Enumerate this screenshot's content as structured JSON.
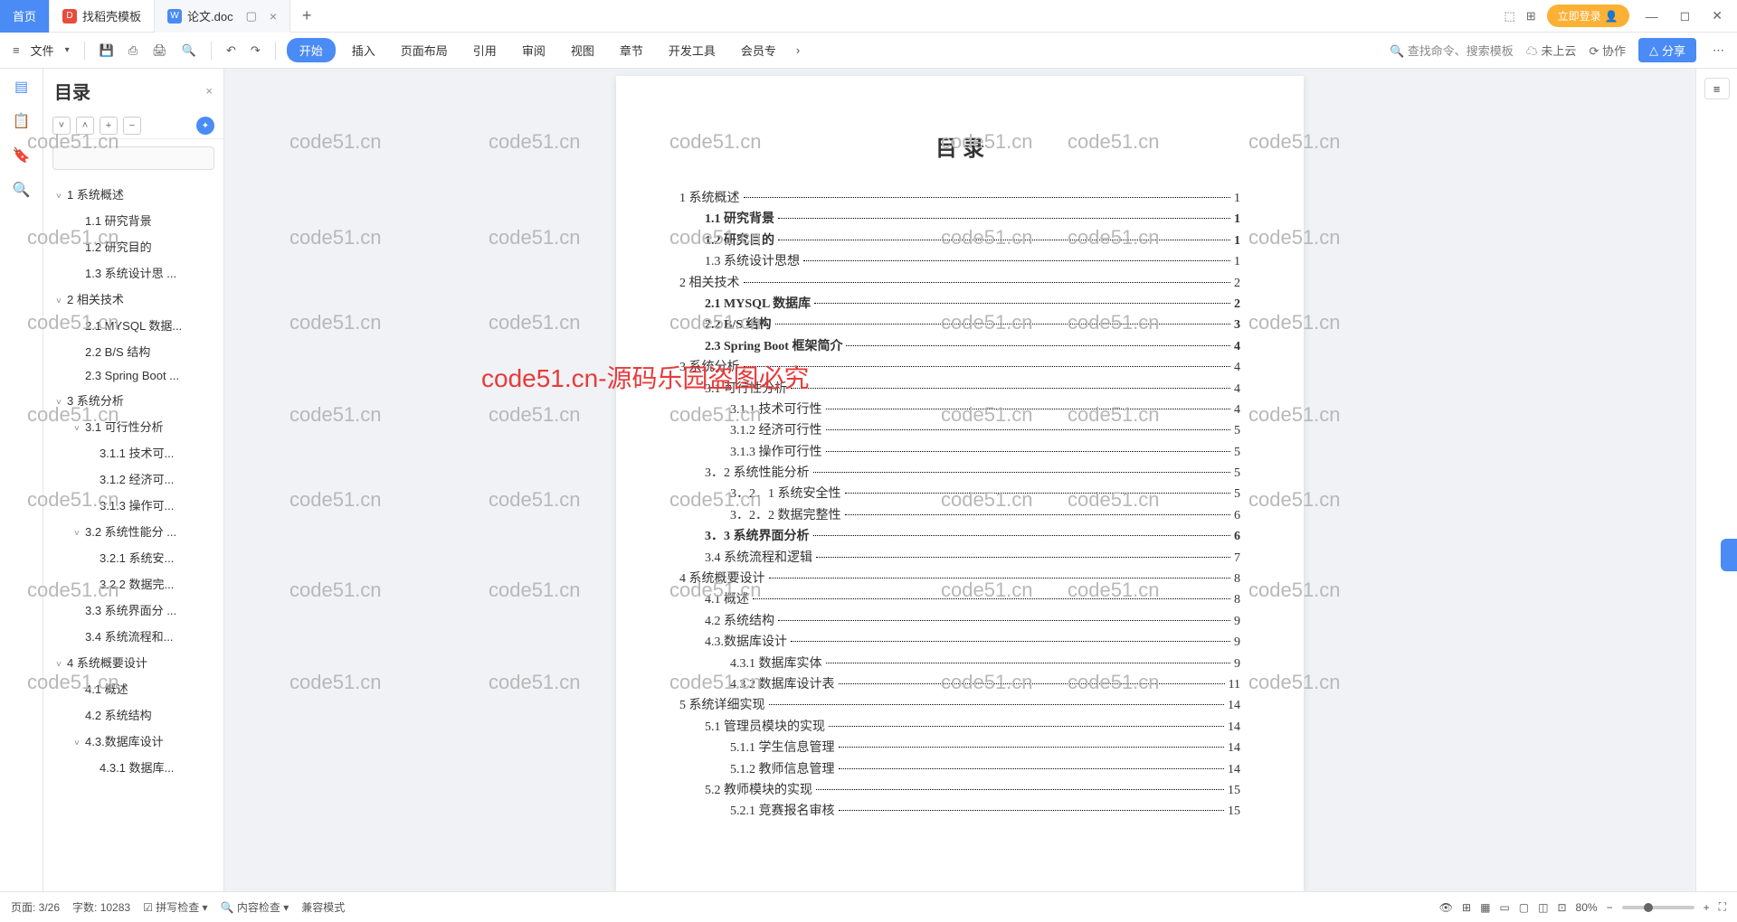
{
  "tabs": {
    "home": "首页",
    "t1": "找稻壳模板",
    "t2": "论文.doc"
  },
  "titlebar": {
    "login": "立即登录"
  },
  "ribbon": {
    "file": "文件",
    "menu": [
      "开始",
      "插入",
      "页面布局",
      "引用",
      "审阅",
      "视图",
      "章节",
      "开发工具",
      "会员专"
    ],
    "search_placeholder": "查找命令、搜索模板",
    "cloud": "未上云",
    "collab": "协作",
    "share": "分享"
  },
  "outline": {
    "title": "目录",
    "items": [
      {
        "lvl": 1,
        "chev": "˅",
        "text": "1 系统概述"
      },
      {
        "lvl": 2,
        "text": "1.1 研究背景"
      },
      {
        "lvl": 2,
        "text": "1.2 研究目的"
      },
      {
        "lvl": 2,
        "text": "1.3 系统设计思 ..."
      },
      {
        "lvl": 1,
        "chev": "˅",
        "text": "2 相关技术"
      },
      {
        "lvl": 2,
        "text": "2.1 MYSQL 数据..."
      },
      {
        "lvl": 2,
        "text": "2.2 B/S 结构"
      },
      {
        "lvl": 2,
        "text": "2.3 Spring Boot ..."
      },
      {
        "lvl": 1,
        "chev": "˅",
        "text": "3 系统分析"
      },
      {
        "lvl": 2,
        "chev": "˅",
        "text": "3.1 可行性分析"
      },
      {
        "lvl": 3,
        "text": "3.1.1 技术可..."
      },
      {
        "lvl": 3,
        "text": "3.1.2 经济可..."
      },
      {
        "lvl": 3,
        "text": "3.1.3 操作可..."
      },
      {
        "lvl": 2,
        "chev": "˅",
        "text": "3.2 系统性能分 ..."
      },
      {
        "lvl": 3,
        "text": "3.2.1 系统安..."
      },
      {
        "lvl": 3,
        "text": "3.2.2 数据完..."
      },
      {
        "lvl": 2,
        "text": "3.3 系统界面分 ..."
      },
      {
        "lvl": 2,
        "text": "3.4 系统流程和..."
      },
      {
        "lvl": 1,
        "chev": "˅",
        "text": "4 系统概要设计"
      },
      {
        "lvl": 2,
        "text": "4.1 概述"
      },
      {
        "lvl": 2,
        "text": "4.2 系统结构"
      },
      {
        "lvl": 2,
        "chev": "˅",
        "text": "4.3.数据库设计"
      },
      {
        "lvl": 3,
        "text": "4.3.1 数据库..."
      }
    ]
  },
  "document": {
    "title": "目 录",
    "toc": [
      {
        "lvl": 1,
        "bold": false,
        "text": "1 系统概述",
        "page": "1"
      },
      {
        "lvl": 2,
        "bold": true,
        "text": "1.1  研究背景",
        "page": "1"
      },
      {
        "lvl": 2,
        "bold": true,
        "text": "1.2 研究目的",
        "page": "1"
      },
      {
        "lvl": 2,
        "bold": false,
        "text": "1.3 系统设计思想",
        "page": "1"
      },
      {
        "lvl": 1,
        "bold": false,
        "text": "2 相关技术",
        "page": "2"
      },
      {
        "lvl": 2,
        "bold": true,
        "text": "2.1 MYSQL 数据库",
        "page": "2"
      },
      {
        "lvl": 2,
        "bold": true,
        "text": "2.2 B/S 结构",
        "page": "3"
      },
      {
        "lvl": 2,
        "bold": true,
        "text": "2.3 Spring Boot 框架简介",
        "page": "4"
      },
      {
        "lvl": 1,
        "bold": false,
        "text": "3 系统分析",
        "page": "4"
      },
      {
        "lvl": 2,
        "bold": false,
        "text": "3.1 可行性分析",
        "page": "4"
      },
      {
        "lvl": 3,
        "bold": false,
        "text": "3.1.1 技术可行性",
        "page": "4"
      },
      {
        "lvl": 3,
        "bold": false,
        "text": "3.1.2 经济可行性",
        "page": "5"
      },
      {
        "lvl": 3,
        "bold": false,
        "text": "3.1.3 操作可行性",
        "page": "5"
      },
      {
        "lvl": 2,
        "bold": false,
        "text": "3．2 系统性能分析",
        "page": "5"
      },
      {
        "lvl": 3,
        "bold": false,
        "text": "3．2．1  系统安全性",
        "page": "5"
      },
      {
        "lvl": 3,
        "bold": false,
        "text": "3．2．2  数据完整性",
        "page": "6"
      },
      {
        "lvl": 2,
        "bold": true,
        "text": "3．3 系统界面分析",
        "page": "6"
      },
      {
        "lvl": 2,
        "bold": false,
        "text": "3.4 系统流程和逻辑",
        "page": "7"
      },
      {
        "lvl": 1,
        "bold": false,
        "text": "4 系统概要设计",
        "page": "8"
      },
      {
        "lvl": 2,
        "bold": false,
        "text": "4.1 概述",
        "page": "8"
      },
      {
        "lvl": 2,
        "bold": false,
        "text": "4.2 系统结构",
        "page": "9"
      },
      {
        "lvl": 2,
        "bold": false,
        "text": "4.3.数据库设计",
        "page": "9"
      },
      {
        "lvl": 3,
        "bold": false,
        "text": "4.3.1 数据库实体",
        "page": "9"
      },
      {
        "lvl": 3,
        "bold": false,
        "text": "4.3.2 数据库设计表",
        "page": "11"
      },
      {
        "lvl": 1,
        "bold": false,
        "text": "5 系统详细实现",
        "page": "14"
      },
      {
        "lvl": 2,
        "bold": false,
        "text": "5.1  管理员模块的实现",
        "page": "14"
      },
      {
        "lvl": 3,
        "bold": false,
        "text": "5.1.1  学生信息管理",
        "page": "14"
      },
      {
        "lvl": 3,
        "bold": false,
        "text": "5.1.2  教师信息管理",
        "page": "14"
      },
      {
        "lvl": 2,
        "bold": false,
        "text": "5.2  教师模块的实现",
        "page": "15"
      },
      {
        "lvl": 3,
        "bold": false,
        "text": "5.2.1  竞赛报名审核",
        "page": "15"
      }
    ]
  },
  "statusbar": {
    "page": "页面: 3/26",
    "words": "字数: 10283",
    "spell": "拼写检查",
    "content": "内容检查",
    "compat": "兼容模式",
    "zoom": "80%"
  },
  "watermark": "code51.cn",
  "watermark_red": "code51.cn-源码乐园盗图必究"
}
